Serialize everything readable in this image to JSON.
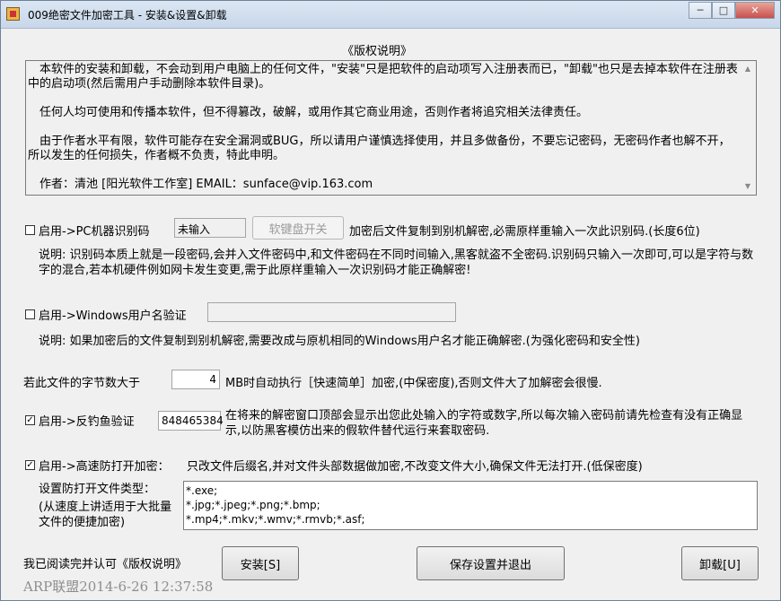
{
  "window": {
    "title": "009绝密文件加密工具 - 安装&设置&卸载"
  },
  "caption": {
    "minimize": "─",
    "maximize": "□",
    "close": "✕"
  },
  "license": {
    "title": "《版权说明》",
    "paragraphs": [
      "本软件的安装和卸载，不会动到用户电脑上的任何文件，\"安装\"只是把软件的启动项写入注册表而已，\"卸载\"也只是去掉本软件在注册表中的启动项(然后需用户手动删除本软件目录)。",
      "任何人均可使用和传播本软件，但不得篡改，破解，或用作其它商业用途，否则作者将追究相关法律责任。",
      "由于作者水平有限，软件可能存在安全漏洞或BUG，所以请用户谨慎选择使用，并且多做备份，不要忘记密码，无密码作者也解不开，所以发生的任何损失，作者概不负责，特此申明。",
      "作者：清池  [阳光软件工作室]       EMAIL：sunface@vip.163.com"
    ]
  },
  "pc_id": {
    "checkbox_label": "启用->PC机器识别码",
    "value": "未输入",
    "keyboard_button": "软键盘开关",
    "hint": "加密后文件复制到别机解密,必需原样重输入一次此识别码.(长度6位)",
    "desc": "说明: 识别码本质上就是一段密码,会并入文件密码中,和文件密码在不同时间输入,黑客就盗不全密码.识别码只输入一次即可,可以是字符与数字的混合,若本机硬件例如网卡发生变更,需于此原样重输入一次识别码才能正确解密!"
  },
  "win_user": {
    "checkbox_label": "启用->Windows用户名验证",
    "value": "",
    "desc": "说明: 如果加密后的文件复制到别机解密,需要改成与原机相同的Windows用户名才能正确解密.(为强化密码和安全性)"
  },
  "size_limit": {
    "label": "若此文件的字节数大于",
    "value": "4",
    "suffix": "MB时自动执行［快速简单］加密,(中保密度),否则文件大了加解密会很慢."
  },
  "anti_phishing": {
    "checkbox_label": "启用->反钓鱼验证",
    "checked": true,
    "value": "848465384",
    "desc": "在将来的解密窗口顶部会显示出您此处输入的字符或数字,所以每次输入密码前请先检查有没有正确显示,以防黑客模仿出来的假软件替代运行来套取密码."
  },
  "fast_open": {
    "checkbox_label": "启用->高速防打开加密：",
    "checked": true,
    "desc": "只改文件后缀名,并对文件头部数据做加密,不改变文件大小,确保文件无法打开.(低保密度)",
    "types_label": "设置防打开文件类型：",
    "types_note": "(从速度上讲适用于大批量文件的便捷加密)",
    "types": [
      "*.exe;",
      "*.jpg;*.jpeg;*.png;*.bmp;",
      "*.mp4;*.mkv;*.wmv;*.rmvb;*.asf;"
    ]
  },
  "footer": {
    "agree": "我已阅读完并认可《版权说明》",
    "install": "安装[S]",
    "save_exit": "保存设置并退出",
    "uninstall": "卸载[U]"
  },
  "watermark": "ARP联盟2014-6-26 12:37:58"
}
